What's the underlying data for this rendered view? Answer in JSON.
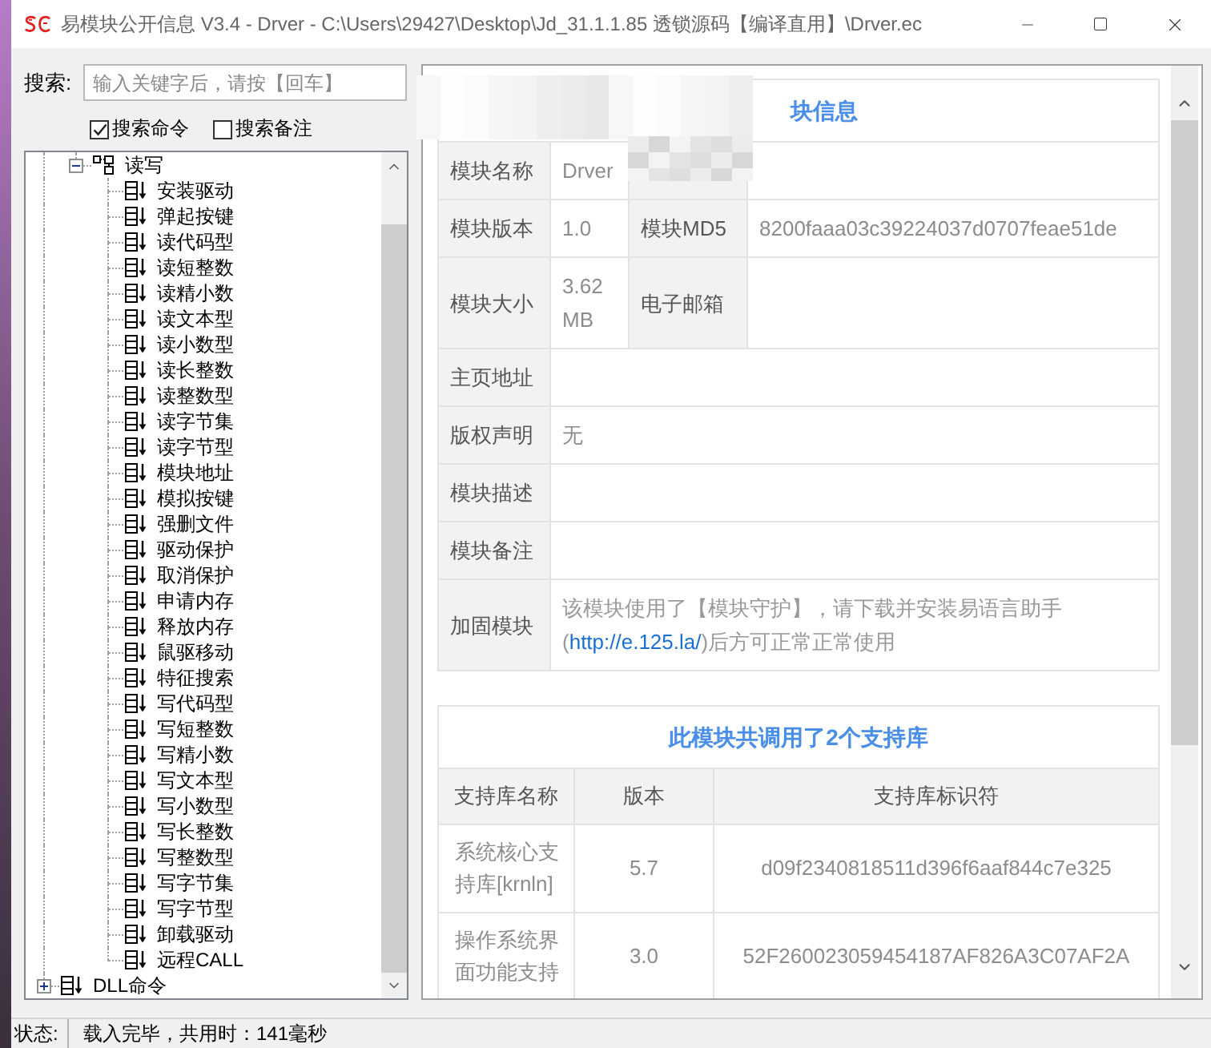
{
  "window": {
    "title": "易模块公开信息 V3.4 - Drver - C:\\Users\\29427\\Desktop\\Jd_31.1.1.85 透锁源码【编译直用】\\Drver.ec"
  },
  "search": {
    "label": "搜索:",
    "placeholder": "输入关键字后，请按【回车】",
    "options": [
      {
        "label": "搜索命令",
        "checked": true
      },
      {
        "label": "搜索备注",
        "checked": false
      }
    ]
  },
  "tree": {
    "nodes": [
      {
        "children": [
          {
            "label": "读写",
            "kind": "group",
            "expanded": true,
            "children": [
              {
                "label": "安装驱动"
              },
              {
                "label": "弹起按键"
              },
              {
                "label": "读代码型"
              },
              {
                "label": "读短整数"
              },
              {
                "label": "读精小数"
              },
              {
                "label": "读文本型"
              },
              {
                "label": "读小数型"
              },
              {
                "label": "读长整数"
              },
              {
                "label": "读整数型"
              },
              {
                "label": "读字节集"
              },
              {
                "label": "读字节型"
              },
              {
                "label": "模块地址"
              },
              {
                "label": "模拟按键"
              },
              {
                "label": "强删文件"
              },
              {
                "label": "驱动保护"
              },
              {
                "label": "取消保护"
              },
              {
                "label": "申请内存"
              },
              {
                "label": "释放内存"
              },
              {
                "label": "鼠驱移动"
              },
              {
                "label": "特征搜索"
              },
              {
                "label": "写代码型"
              },
              {
                "label": "写短整数"
              },
              {
                "label": "写精小数"
              },
              {
                "label": "写文本型"
              },
              {
                "label": "写小数型"
              },
              {
                "label": "写长整数"
              },
              {
                "label": "写整数型"
              },
              {
                "label": "写字节集"
              },
              {
                "label": "写字节型"
              },
              {
                "label": "卸载驱动"
              },
              {
                "label": "远程CALL"
              }
            ]
          }
        ]
      },
      {
        "label": "DLL命令",
        "expanded": false
      }
    ]
  },
  "module_info": {
    "title": "块信息",
    "rows": [
      {
        "fields": [
          {
            "label": "模块名称",
            "value": "Drver"
          },
          {
            "covered": true
          }
        ]
      },
      {
        "fields": [
          {
            "label": "模块版本",
            "value": "1.0"
          },
          {
            "label": "模块MD5",
            "value": "8200faaa03c39224037d0707feae51de"
          }
        ]
      },
      {
        "fields": [
          {
            "label": "模块大小",
            "value": "3.62 MB"
          },
          {
            "label": "电子邮箱"
          }
        ]
      },
      {
        "fields": [
          {
            "label": "主页地址"
          }
        ]
      },
      {
        "fields": [
          {
            "label": "版权声明",
            "value": "无"
          }
        ]
      },
      {
        "fields": [
          {
            "label": "模块描述"
          }
        ]
      },
      {
        "fields": [
          {
            "label": "模块备注"
          }
        ]
      },
      {
        "fields": [
          {
            "label": "加固模块",
            "notice": {
              "before": "该模块使用了【模块守护】，请下载并安装易语言助手(",
              "link": "http://e.125.la/",
              "after": ")后方可正常正常使用"
            }
          }
        ]
      }
    ]
  },
  "libraries": {
    "title": "此模块共调用了2个支持库",
    "columns": [
      "支持库名称",
      "版本",
      "支持库标识符"
    ],
    "rows": [
      [
        "系统核心支持库[krnln]",
        "5.7",
        "d09f2340818511d396f6aaf844c7e325"
      ],
      [
        "操作系统界面功能支持",
        "3.0",
        "52F260023059454187AF826A3C07AF2A"
      ]
    ]
  },
  "status_bar": {
    "label": "状态:",
    "message": "载入完毕，共用时：141毫秒"
  }
}
